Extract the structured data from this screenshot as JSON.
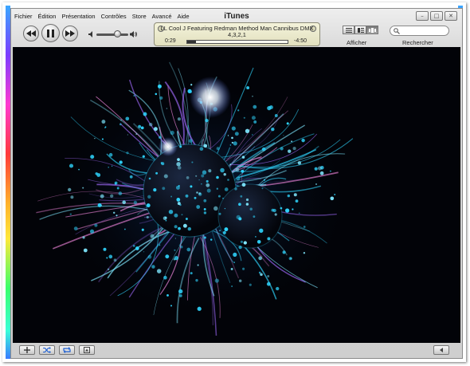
{
  "window": {
    "title": "iTunes"
  },
  "menu": [
    "Fichier",
    "Édition",
    "Présentation",
    "Contrôles",
    "Store",
    "Avancé",
    "Aide"
  ],
  "now_playing": {
    "line1": "LL Cool J Featuring Redman Method Man Cannibus DMX",
    "line2": "4,3,2,1",
    "elapsed": "0:29",
    "remaining": "-4:50",
    "progress": 0.09
  },
  "volume_level": 0.65,
  "view": {
    "label": "Afficher",
    "options": [
      "list-view-icon",
      "album-view-icon",
      "coverflow-view-icon"
    ],
    "active_index": 2
  },
  "search": {
    "label": "Rechercher",
    "value": ""
  },
  "colors": {
    "visual_bg": "#020308",
    "particle_cyan": "#2fd6ff",
    "particle_purple": "#a36bff"
  }
}
